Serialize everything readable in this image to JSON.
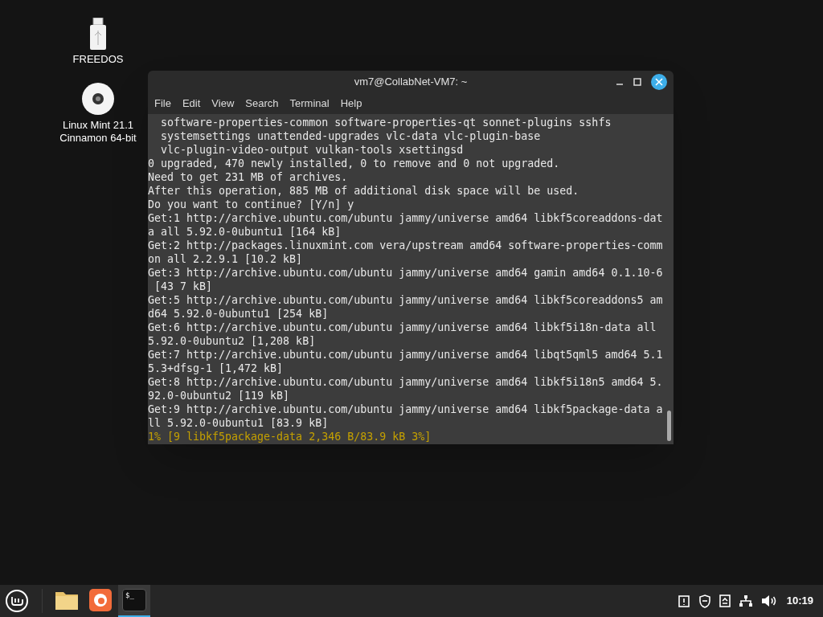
{
  "desktop_icons": [
    {
      "kind": "usb",
      "label": "FREEDOS"
    },
    {
      "kind": "disc",
      "label": "Linux Mint 21.1\nCinnamon 64-bit"
    }
  ],
  "window": {
    "title": "vm7@CollabNet-VM7: ~",
    "menu": [
      "File",
      "Edit",
      "View",
      "Search",
      "Terminal",
      "Help"
    ],
    "lines": [
      {
        "kind": "output",
        "text": "  software-properties-common software-properties-qt sonnet-plugins sshfs"
      },
      {
        "kind": "output",
        "text": "  systemsettings unattended-upgrades vlc-data vlc-plugin-base"
      },
      {
        "kind": "output",
        "text": "  vlc-plugin-video-output vulkan-tools xsettingsd"
      },
      {
        "kind": "output",
        "text": "0 upgraded, 470 newly installed, 0 to remove and 0 not upgraded."
      },
      {
        "kind": "output",
        "text": "Need to get 231 MB of archives."
      },
      {
        "kind": "output",
        "text": "After this operation, 885 MB of additional disk space will be used."
      },
      {
        "kind": "output",
        "text": "Do you want to continue? [Y/n] y"
      },
      {
        "kind": "output",
        "text": "Get:1 http://archive.ubuntu.com/ubuntu jammy/universe amd64 libkf5coreaddons-dat"
      },
      {
        "kind": "output",
        "text": "a all 5.92.0-0ubuntu1 [164 kB]"
      },
      {
        "kind": "output",
        "text": "Get:2 http://packages.linuxmint.com vera/upstream amd64 software-properties-comm"
      },
      {
        "kind": "output",
        "text": "on all 2.2.9.1 [10.2 kB]"
      },
      {
        "kind": "output",
        "text": "Get:3 http://archive.ubuntu.com/ubuntu jammy/universe amd64 gamin amd64 0.1.10-6"
      },
      {
        "kind": "output",
        "text": " [43 7 kB]"
      },
      {
        "kind": "output",
        "text": "Get:5 http://archive.ubuntu.com/ubuntu jammy/universe amd64 libkf5coreaddons5 am"
      },
      {
        "kind": "output",
        "text": "d64 5.92.0-0ubuntu1 [254 kB]"
      },
      {
        "kind": "output",
        "text": "Get:6 http://archive.ubuntu.com/ubuntu jammy/universe amd64 libkf5i18n-data all"
      },
      {
        "kind": "output",
        "text": "5.92.0-0ubuntu2 [1,208 kB]"
      },
      {
        "kind": "output",
        "text": "Get:7 http://archive.ubuntu.com/ubuntu jammy/universe amd64 libqt5qml5 amd64 5.1"
      },
      {
        "kind": "output",
        "text": "5.3+dfsg-1 [1,472 kB]"
      },
      {
        "kind": "output",
        "text": "Get:8 http://archive.ubuntu.com/ubuntu jammy/universe amd64 libkf5i18n5 amd64 5."
      },
      {
        "kind": "output",
        "text": "92.0-0ubuntu2 [119 kB]"
      },
      {
        "kind": "output",
        "text": "Get:9 http://archive.ubuntu.com/ubuntu jammy/universe amd64 libkf5package-data a"
      },
      {
        "kind": "output",
        "text": "ll 5.92.0-0ubuntu1 [83.9 kB]"
      },
      {
        "kind": "progress",
        "text": "1% [9 libkf5package-data 2,346 B/83.9 kB 3%]"
      }
    ]
  },
  "taskbar": {
    "apps": [
      {
        "kind": "files",
        "selected": false
      },
      {
        "kind": "browser",
        "selected": false
      },
      {
        "kind": "terminal",
        "selected": true,
        "label": "$_"
      }
    ],
    "tray": [
      {
        "kind": "notes"
      },
      {
        "kind": "shield"
      },
      {
        "kind": "updates"
      },
      {
        "kind": "network"
      },
      {
        "kind": "volume"
      }
    ],
    "clock": "10:19"
  }
}
